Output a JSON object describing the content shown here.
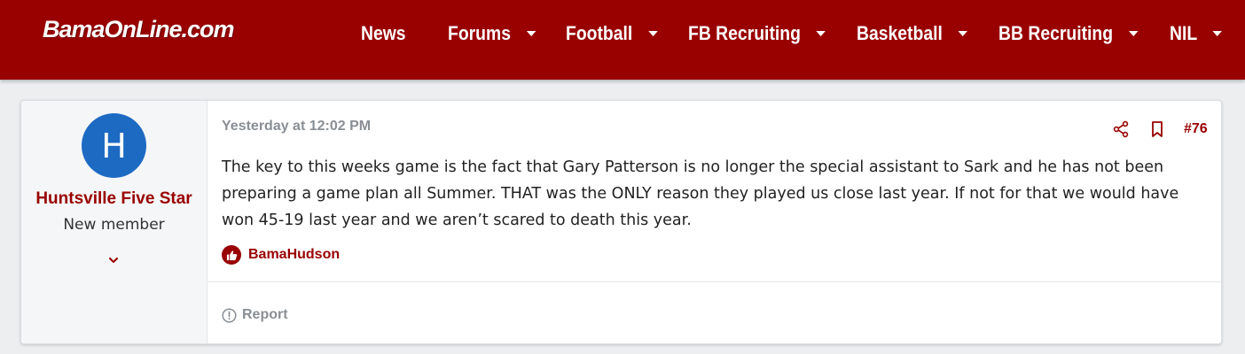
{
  "header": {
    "logo_text": "BamaOnLine.com",
    "brand_color": "#990000",
    "nav": [
      {
        "label": "News",
        "has_dropdown": false
      },
      {
        "label": "Forums",
        "has_dropdown": true
      },
      {
        "label": "Football",
        "has_dropdown": true
      },
      {
        "label": "FB Recruiting",
        "has_dropdown": true
      },
      {
        "label": "Basketball",
        "has_dropdown": true
      },
      {
        "label": "BB Recruiting",
        "has_dropdown": true
      },
      {
        "label": "NIL",
        "has_dropdown": true
      }
    ]
  },
  "post": {
    "author": {
      "avatar_letter": "H",
      "avatar_color": "#1d6ac3",
      "username": "Huntsville Five Star",
      "title": "New member",
      "expand_icon": "chevron-down-icon"
    },
    "timestamp": "Yesterday at 12:02 PM",
    "actions": {
      "share_icon": "share-icon",
      "bookmark_icon": "bookmark-icon",
      "post_number": "#76"
    },
    "body": "The key to this weeks game is the fact that Gary Patterson is no longer the special assistant to Sark and he has not been preparing a game plan all Summer. THAT was the ONLY reason they played us close last year. If not for that we would have won 45-19 last year and we aren’t scared to death this year.",
    "reactions": {
      "icon": "thumbs-up-icon",
      "users": "BamaHudson"
    },
    "footer": {
      "report_label": "Report",
      "report_icon": "alert-circle-icon"
    }
  }
}
